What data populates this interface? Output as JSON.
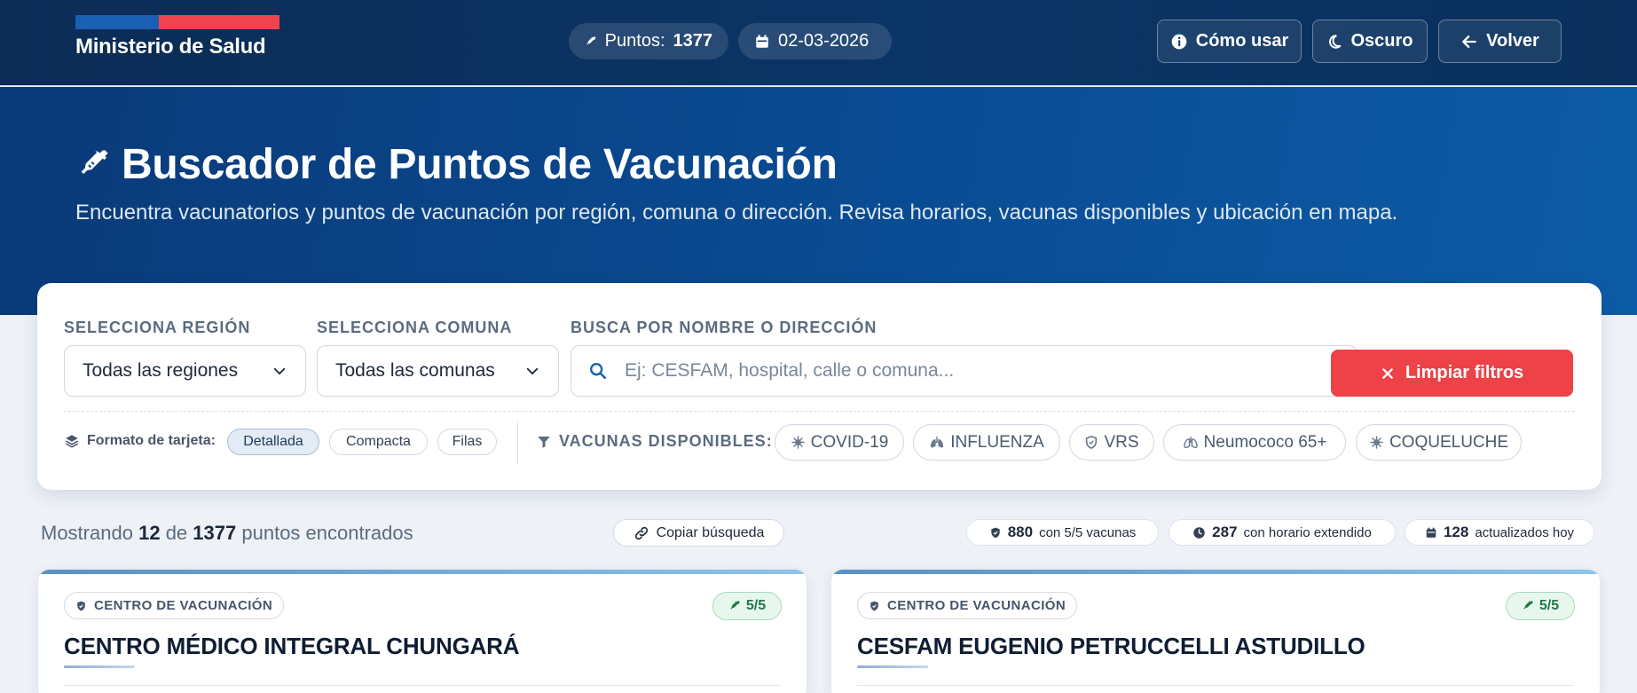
{
  "brand": {
    "logo_text": "Ministerio de Salud"
  },
  "header": {
    "points_label": "Puntos:",
    "points_value": "1377",
    "date": "02-03-2026",
    "buttons": {
      "help": "Cómo usar",
      "theme": "Oscuro",
      "back": "Volver"
    }
  },
  "hero": {
    "title": "Buscador de Puntos de Vacunación",
    "subtitle": "Encuentra vacunatorios y puntos de vacunación por región, comuna o dirección. Revisa horarios, vacunas disponibles y ubicación en mapa."
  },
  "filters": {
    "region_label": "SELECCIONA REGIÓN",
    "region_value": "Todas las regiones",
    "comuna_label": "SELECCIONA COMUNA",
    "comuna_value": "Todas las comunas",
    "search_label": "BUSCA POR NOMBRE O DIRECCIÓN",
    "search_placeholder": "Ej: CESFAM, hospital, calle o comuna...",
    "clear_button": "Limpiar filtros",
    "format_label": "Formato de tarjeta:",
    "formats": [
      "Detallada",
      "Compacta",
      "Filas"
    ],
    "format_selected": "Detallada",
    "vaccines_label": "VACUNAS DISPONIBLES:",
    "vaccines": [
      "COVID-19",
      "INFLUENZA",
      "VRS",
      "Neumococo 65+",
      "COQUELUCHE"
    ]
  },
  "results": {
    "prefix": "Mostrando",
    "shown": "12",
    "of": "de",
    "total": "1377",
    "suffix": "puntos encontrados",
    "copy_button": "Copiar búsqueda",
    "stats": [
      {
        "value": "880",
        "label": "con 5/5 vacunas"
      },
      {
        "value": "287",
        "label": "con horario extendido"
      },
      {
        "value": "128",
        "label": "actualizados hoy"
      }
    ]
  },
  "cards": [
    {
      "type": "CENTRO DE VACUNACIÓN",
      "score": "5/5",
      "name": "CENTRO MÉDICO INTEGRAL CHUNGARÁ"
    },
    {
      "type": "CENTRO DE VACUNACIÓN",
      "score": "5/5",
      "name": "CESFAM EUGENIO PETRUCCELLI ASTUDILLO"
    }
  ],
  "colors": {
    "accent_red": "#ec4248",
    "navy": "#0b2c55",
    "success_green": "#1e7a46"
  }
}
